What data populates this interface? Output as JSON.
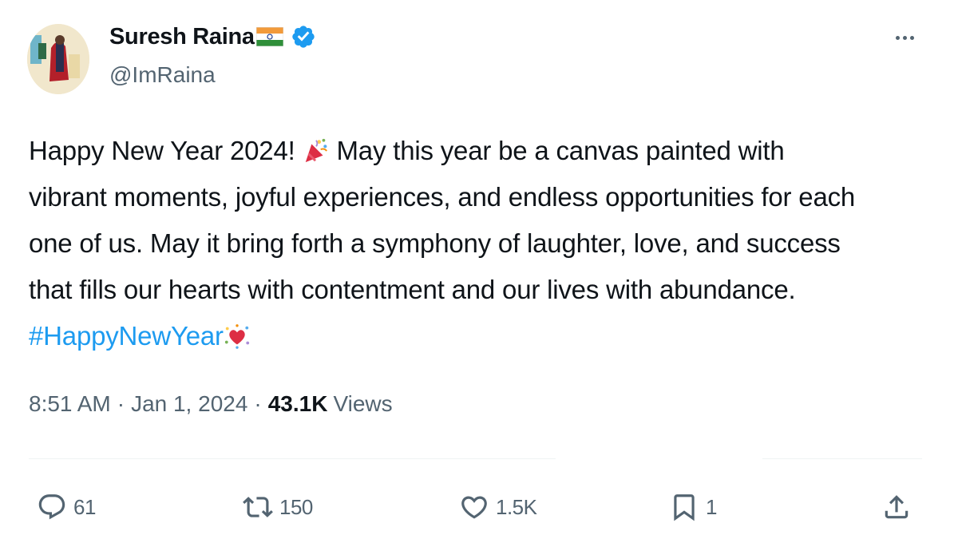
{
  "author": {
    "name": "Suresh Raina",
    "handle": "@ImRaina",
    "flag_icon": "india-flag",
    "verified_icon": "verified-badge"
  },
  "tweet": {
    "lines": [
      "Happy New Year 2024!",
      " May this year be a canvas painted with",
      "vibrant moments, joyful experiences, and endless opportunities for each",
      "one of us. May it bring forth a symphony of laughter, love, and success",
      "that fills our hearts with contentment and our lives with abundance."
    ],
    "hashtag": "#HappyNewYear",
    "emoji_1": "party-popper",
    "emoji_2": "sparkling-heart"
  },
  "meta": {
    "time": "8:51 AM",
    "separator": "·",
    "date": "Jan 1, 2024",
    "views_count": "43.1K",
    "views_label": "Views"
  },
  "actions": {
    "replies": "61",
    "reposts": "150",
    "likes": "1.5K",
    "bookmarks": "1"
  },
  "colors": {
    "accent": "#1d9bf0",
    "text": "#0f1419",
    "secondary": "#536471"
  }
}
